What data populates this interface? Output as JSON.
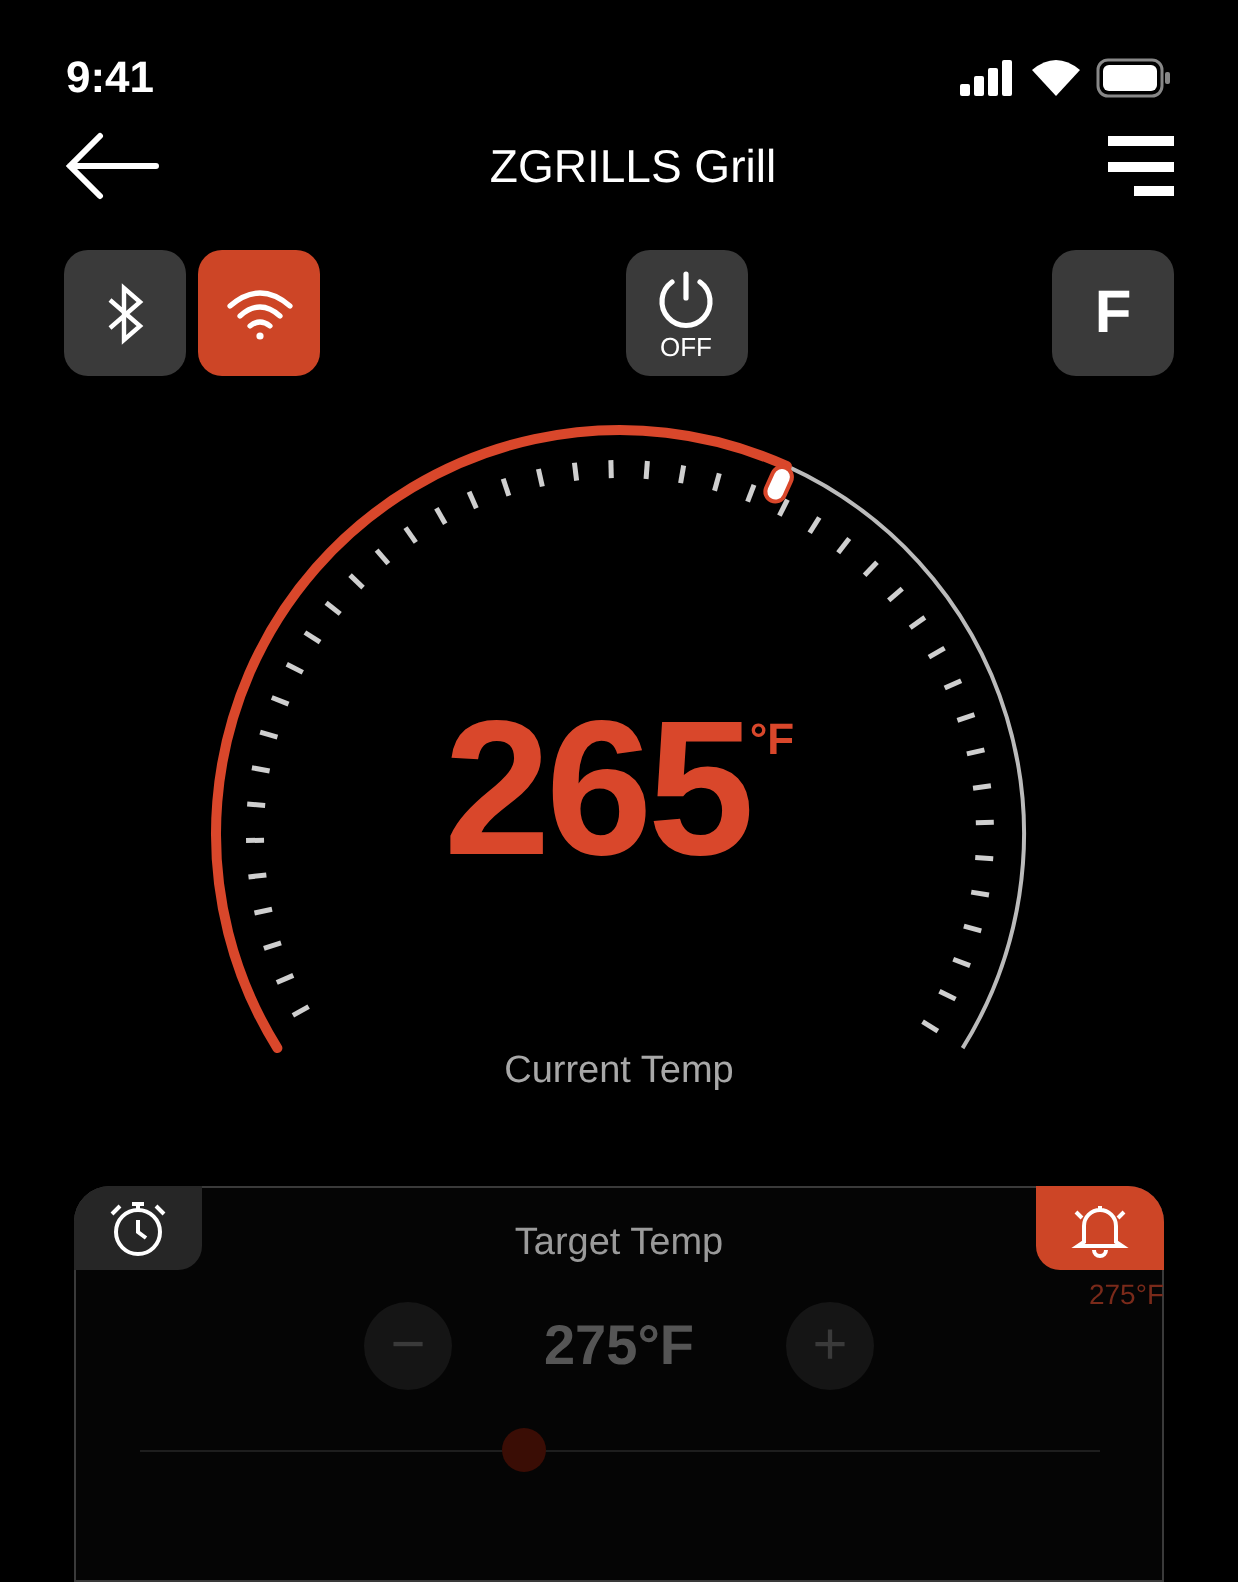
{
  "status_bar": {
    "time": "9:41"
  },
  "header": {
    "title": "ZGRILLS Grill"
  },
  "connections": [
    {
      "kind": "bluetooth",
      "on": false
    },
    {
      "kind": "wifi",
      "on": true
    }
  ],
  "power": {
    "label": "OFF",
    "on": false
  },
  "unit_button": {
    "label": "F"
  },
  "gauge": {
    "value": "265",
    "unit": "°F",
    "caption": "Current Temp"
  },
  "target_card": {
    "modes": [
      {
        "kind": "timer",
        "selected": false
      },
      {
        "kind": "alarm",
        "selected": true
      }
    ],
    "alarm_reading": "275°F",
    "title": "Target Temp",
    "value": "275°F",
    "minus": "−",
    "plus": "+",
    "slider": {
      "level": 0.4
    }
  }
}
